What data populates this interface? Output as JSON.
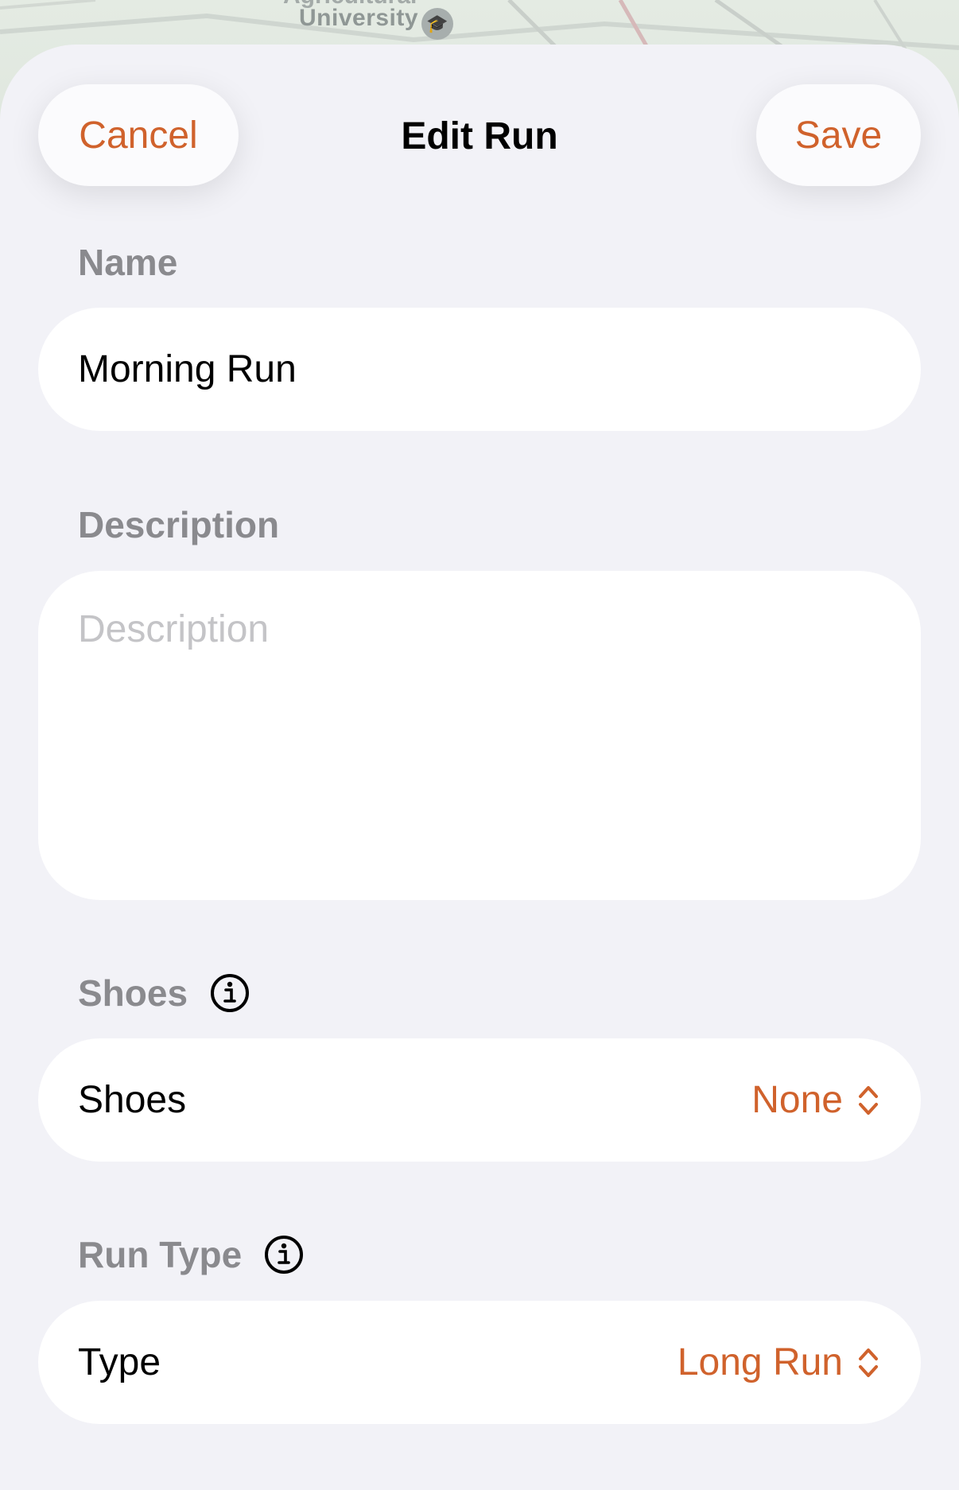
{
  "map": {
    "label_top": "Agricultural",
    "label": "University"
  },
  "header": {
    "cancel_label": "Cancel",
    "title": "Edit Run",
    "save_label": "Save"
  },
  "name_section": {
    "label": "Name",
    "value": "Morning Run"
  },
  "description_section": {
    "label": "Description",
    "placeholder": "Description",
    "value": ""
  },
  "shoes_section": {
    "label": "Shoes",
    "row_label": "Shoes",
    "selected_value": "None"
  },
  "run_type_section": {
    "label": "Run Type",
    "row_label": "Type",
    "selected_value": "Long Run"
  },
  "colors": {
    "accent": "#d0622c",
    "background": "#f2f2f7",
    "field": "#ffffff",
    "section_label": "#8a8a8e",
    "placeholder": "#c4c4c7"
  },
  "icons": {
    "info": "info-circle-icon",
    "chevron": "chevron-up-down-icon",
    "poi": "graduation-cap-icon"
  }
}
